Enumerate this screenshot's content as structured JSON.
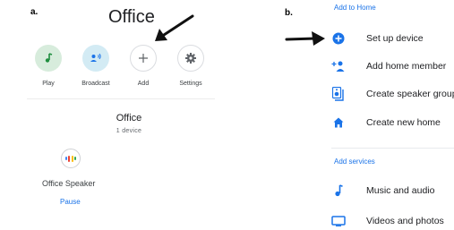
{
  "panel_a": {
    "tag": "a.",
    "room_title": "Office",
    "quick_actions": [
      {
        "label": "Play",
        "icon": "music-note-icon"
      },
      {
        "label": "Broadcast",
        "icon": "broadcast-icon"
      },
      {
        "label": "Add",
        "icon": "plus-icon"
      },
      {
        "label": "Settings",
        "icon": "gear-icon"
      }
    ],
    "device_section": {
      "title": "Office",
      "count": "1 device",
      "device_name": "Office Speaker",
      "action": "Pause"
    },
    "colors": {
      "accent": "#1a73e8",
      "play_bg": "#d7ecdc",
      "broadcast_bg": "#d3ebf4"
    }
  },
  "panel_b": {
    "tag": "b.",
    "sections": [
      {
        "header": "Add to Home",
        "items": [
          {
            "label": "Set up device",
            "icon": "add-circle-icon"
          },
          {
            "label": "Add home member",
            "icon": "add-person-icon"
          },
          {
            "label": "Create speaker group",
            "icon": "speaker-group-icon"
          },
          {
            "label": "Create new home",
            "icon": "home-icon"
          }
        ]
      },
      {
        "header": "Add services",
        "items": [
          {
            "label": "Music and audio",
            "icon": "music-note-icon"
          },
          {
            "label": "Videos and photos",
            "icon": "tv-icon"
          }
        ]
      }
    ],
    "colors": {
      "icon": "#1a73e8"
    }
  },
  "annotations": [
    {
      "icon": "arrow-annotation-icon",
      "points_to": "Add"
    },
    {
      "icon": "arrow-annotation-icon",
      "points_to": "Set up device"
    }
  ]
}
